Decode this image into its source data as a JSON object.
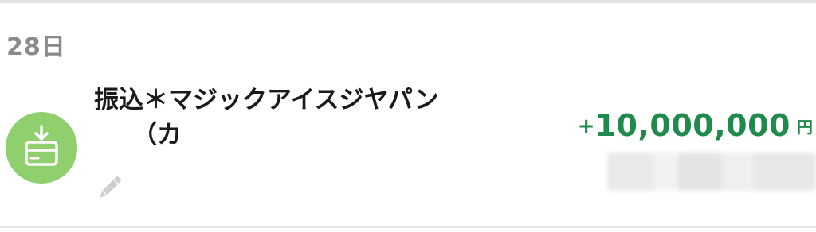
{
  "date_header": "28日",
  "transaction": {
    "payee_line1": "振込＊マジックアイスジヤパン",
    "payee_line2": "（カ",
    "icon": "bank-card-deposit-icon",
    "edit_icon": "pencil-icon",
    "amount_sign": "+",
    "amount_value": "10,000,000",
    "amount_unit": "円",
    "balance_redacted": true
  },
  "colors": {
    "icon_background": "#8fcf6e",
    "amount": "#1f8a4c",
    "date_header": "#8a8a8a",
    "payee_text": "#1a1a1a",
    "divider": "#e4e4e4"
  }
}
